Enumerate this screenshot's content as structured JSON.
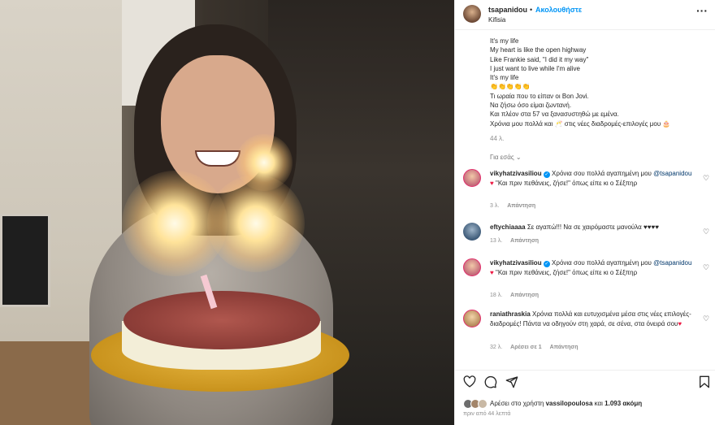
{
  "post": {
    "username": "tsapanidou",
    "dot": "•",
    "follow_label": "Ακολουθήστε",
    "location": "Kifisia",
    "more_label": "···"
  },
  "caption": {
    "lines": [
      "It's my life",
      "My heart is like the open highway",
      "Like Frankie said, \"I did it my way\"",
      "I just want to live while I'm alive",
      "It's my life",
      "👏👏👏👏👏",
      "Τι ωραία που το είπαν οι Bon Jovi.",
      "Να ζήσω όσο είμαι ζωντανή.",
      "Και πλέον στα 57 να ξανασυστηθώ με εμένα.",
      "Χρόνια μου πολλά και 🥂 στις νέες διαδρομές-επιλογές μου 🎂"
    ],
    "time": "44 λ."
  },
  "for_you_label": "Για εσάς ⌄",
  "comments": [
    {
      "username": "vikyhatzivasiliou",
      "verified": "✓",
      "text_a": " Χρόνια σου πολλά αγαπημένη μου ",
      "mention": "@tsapanidou",
      "heart": " ♥",
      "text_b": " \"Και πριν πεθάνεις, ζήσε!\" όπως είπε κι ο Σέξπηρ",
      "time": "3 λ.",
      "likes": "",
      "reply": "Απάντηση"
    },
    {
      "username": "eftychiaaaa",
      "text": " Σε αγαπώ!!! Να σε χαιρόμαστε μανούλα ♥♥♥♥",
      "time": "13 λ.",
      "reply": "Απάντηση"
    },
    {
      "username": "vikyhatzivasiliou",
      "verified": "✓",
      "text_a": " Χρόνια σου πολλά αγαπημένη μου ",
      "mention": "@tsapanidou",
      "heart": " ♥",
      "text_b": " \"Και πριν πεθάνεις, ζήσε!\" όπως είπε κι ο Σέξπηρ",
      "time": "18 λ.",
      "reply": "Απάντηση"
    },
    {
      "username": "raniathraskia",
      "text": " Χρόνια πολλά και ευτυχισμένα μέσα στις νέες επιλογές-διαδρομές! Πάντα να οδηγούν στη χαρά, σε σένα, στα όνειρά σου",
      "heart": "♥",
      "time": "32 λ.",
      "likes": "Αρέσει σε 1",
      "reply": "Απάντηση"
    }
  ],
  "actions": {
    "like_icon": "heart-outline-icon",
    "comment_icon": "comment-icon",
    "share_icon": "share-icon",
    "save_icon": "bookmark-icon"
  },
  "liked_by": {
    "prefix": "Αρέσει στο χρήστη ",
    "user": "vassilopoulosa",
    "middle": " και ",
    "count": "1.093 ακόμη"
  },
  "post_time": "πριν από 44 λεπτά",
  "colors": {
    "accent": "#0095f6",
    "heart": "#ed1b44",
    "muted": "#8e8e8e"
  }
}
